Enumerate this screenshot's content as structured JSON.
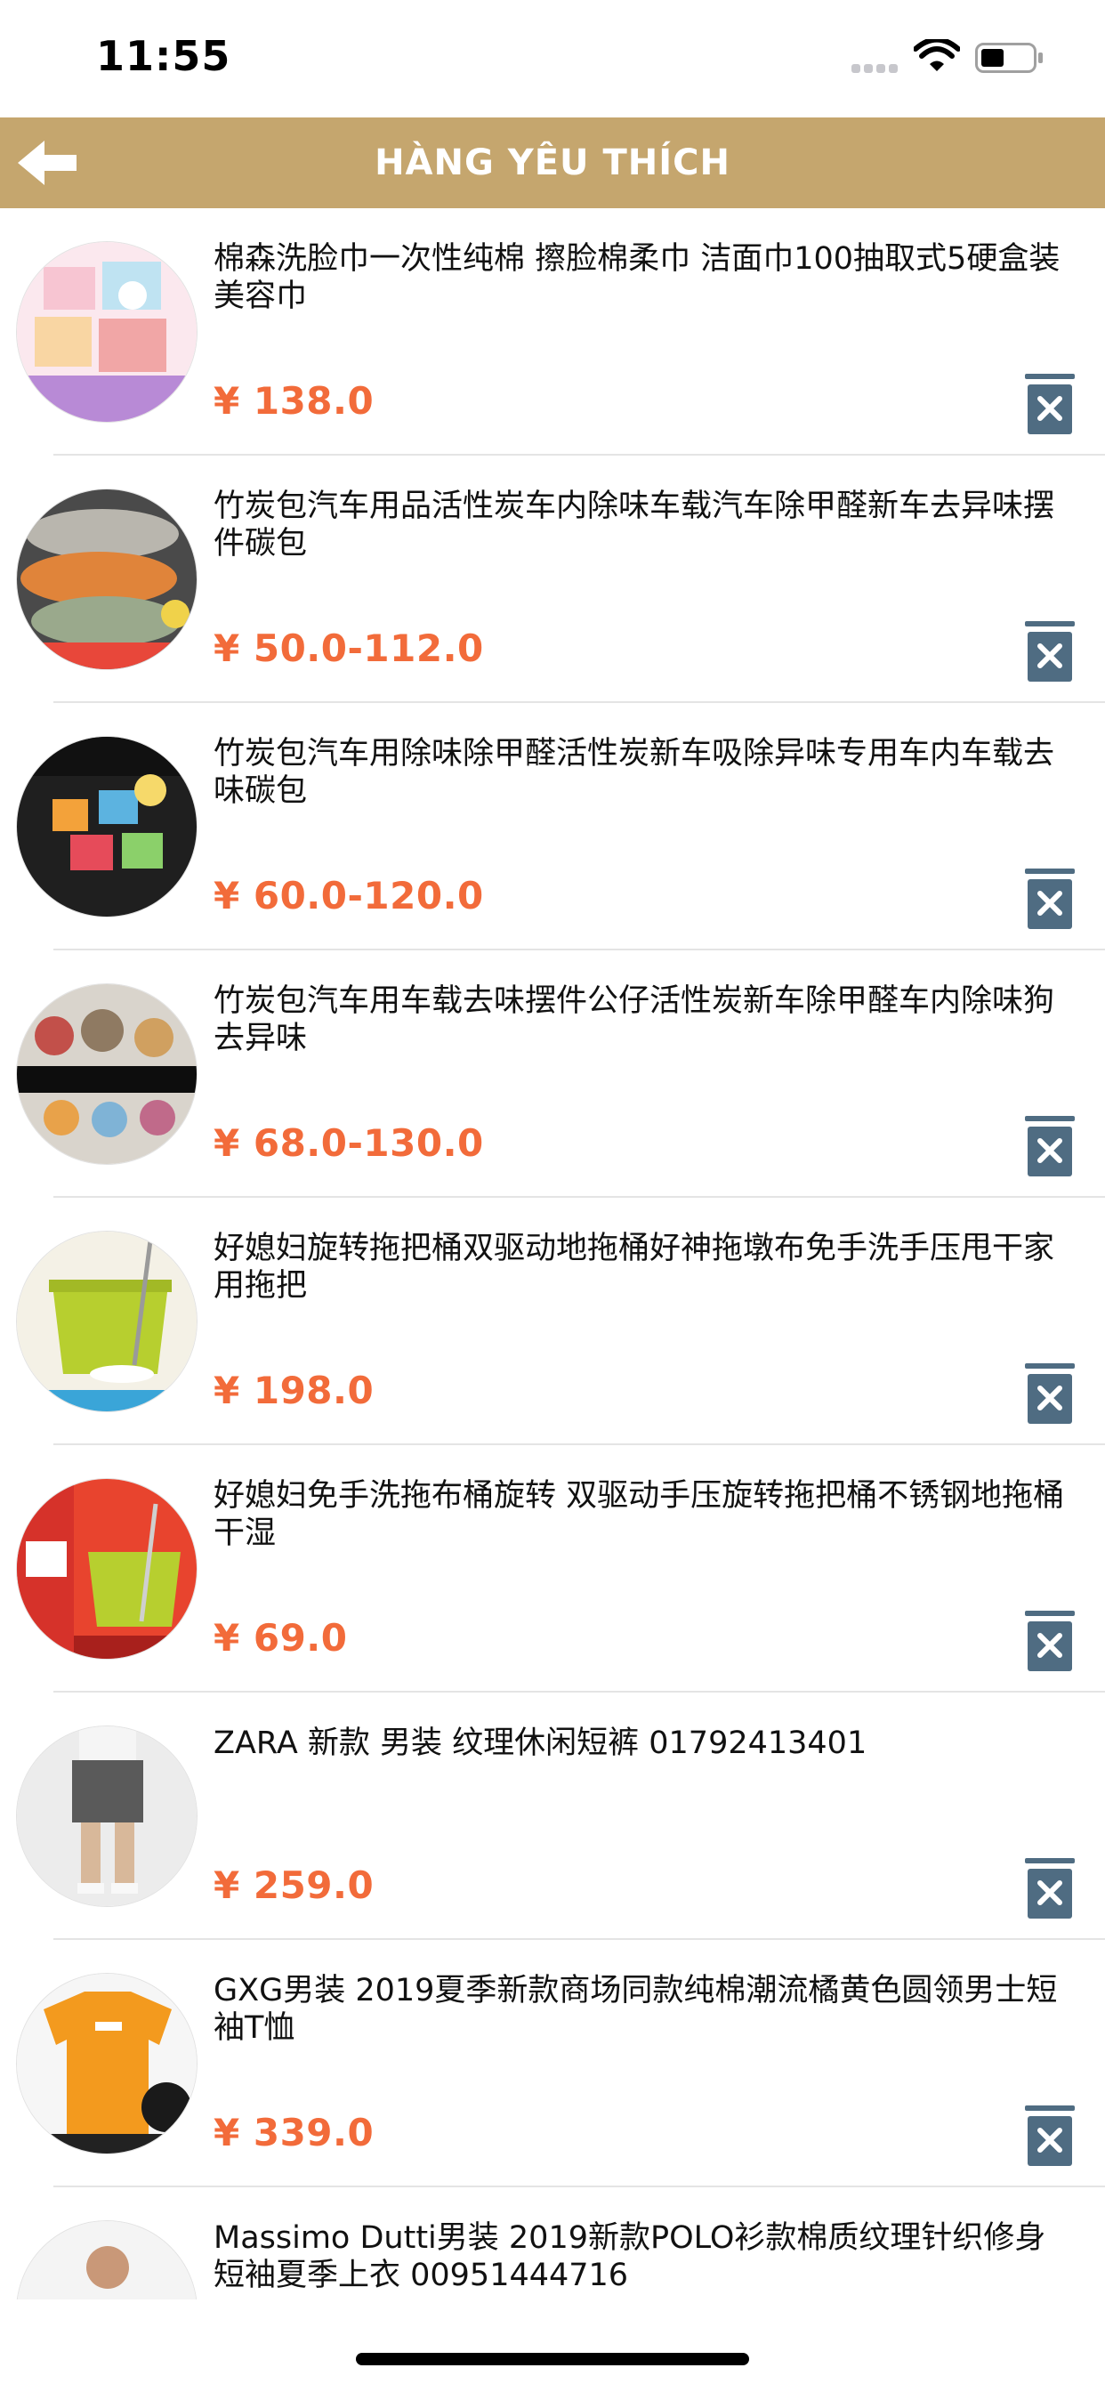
{
  "status_bar": {
    "time": "11:55"
  },
  "header": {
    "title": "HÀNG YÊU THÍCH"
  },
  "colors": {
    "header_bg": "#c5a66e",
    "price": "#f26b3a",
    "delete_icon": "#4f6c82"
  },
  "icons": {
    "back": "arrow-left-icon",
    "delete": "trash-x-icon"
  },
  "items": [
    {
      "title": "棉森洗脸巾一次性纯棉 擦脸棉柔巾 洁面巾100抽取式5硬盒装美容巾",
      "price": "¥ 138.0"
    },
    {
      "title": "竹炭包汽车用品活性炭车内除味车载汽车除甲醛新车去异味摆件碳包",
      "price": "¥ 50.0-112.0"
    },
    {
      "title": "竹炭包汽车用除味除甲醛活性炭新车吸除异味专用车内车载去味碳包",
      "price": "¥ 60.0-120.0"
    },
    {
      "title": "竹炭包汽车用车载去味摆件公仔活性炭新车除甲醛车内除味狗去异味",
      "price": "¥ 68.0-130.0"
    },
    {
      "title": "好媳妇旋转拖把桶双驱动地拖桶好神拖墩布免手洗手压甩干家用拖把",
      "price": "¥ 198.0"
    },
    {
      "title": "好媳妇免手洗拖布桶旋转 双驱动手压旋转拖把桶不锈钢地拖桶干湿",
      "price": "¥ 69.0"
    },
    {
      "title": "ZARA 新款 男装 纹理休闲短裤 01792413401",
      "price": "¥ 259.0"
    },
    {
      "title": "GXG男装 2019夏季新款商场同款纯棉潮流橘黄色圆领男士短袖T恤",
      "price": "¥ 339.0"
    },
    {
      "title": "Massimo Dutti男装 2019新款POLO衫款棉质纹理针织修身短袖夏季上衣 00951444716",
      "price": ""
    }
  ]
}
